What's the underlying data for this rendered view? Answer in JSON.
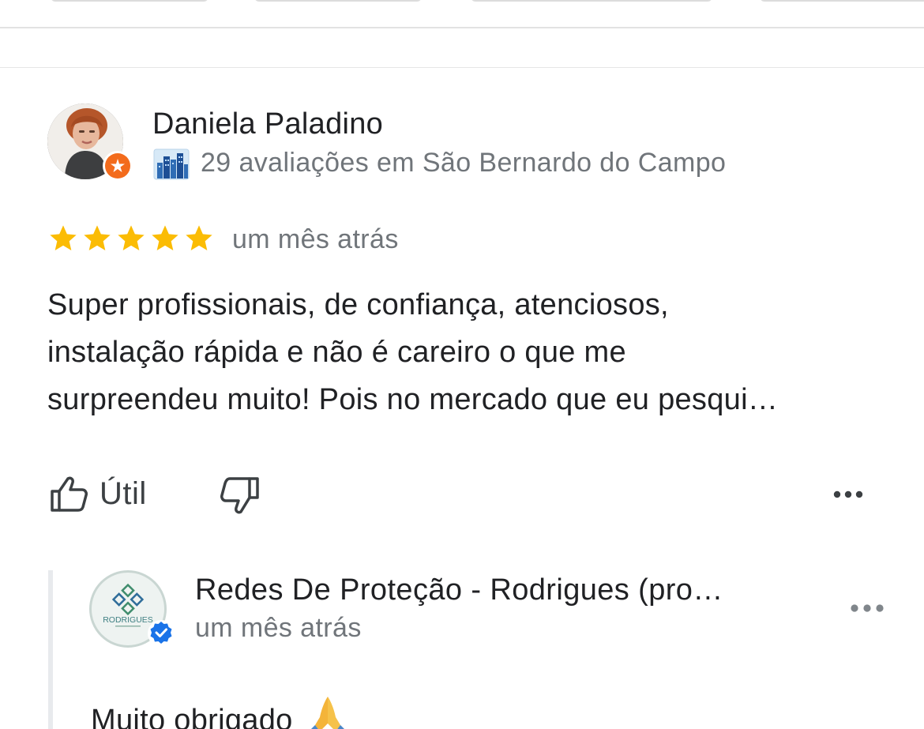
{
  "review": {
    "reviewer_name": "Daniela Paladino",
    "reviewer_meta": "29 avaliações em São Bernardo do Campo",
    "rating": 5,
    "rating_max": 5,
    "star_color": "#FBBC04",
    "time": "um mês atrás",
    "text_lines": [
      "Super profissionais, de confiança, atenciosos,",
      "instalação rápida e não é careiro o que me",
      "surpreendeu muito! Pois no mercado que eu pesqui…"
    ]
  },
  "actions": {
    "like_label": "Útil",
    "like_icon": "thumbs-up-icon",
    "dislike_icon": "thumbs-down-icon",
    "more_icon": "more-horizontal-icon"
  },
  "owner_reply": {
    "owner_name": "Redes De Proteção - Rodrigues (pro…",
    "logo_text": "RODRIGUES",
    "time": "um mês atrás",
    "text": "Muito obrigado",
    "emoji_icon": "praying-hands-icon",
    "verified_color": "#1A73E8"
  },
  "colors": {
    "local_guide_badge": "#F36B1C",
    "text_primary": "#202124",
    "text_secondary": "#70757A"
  }
}
